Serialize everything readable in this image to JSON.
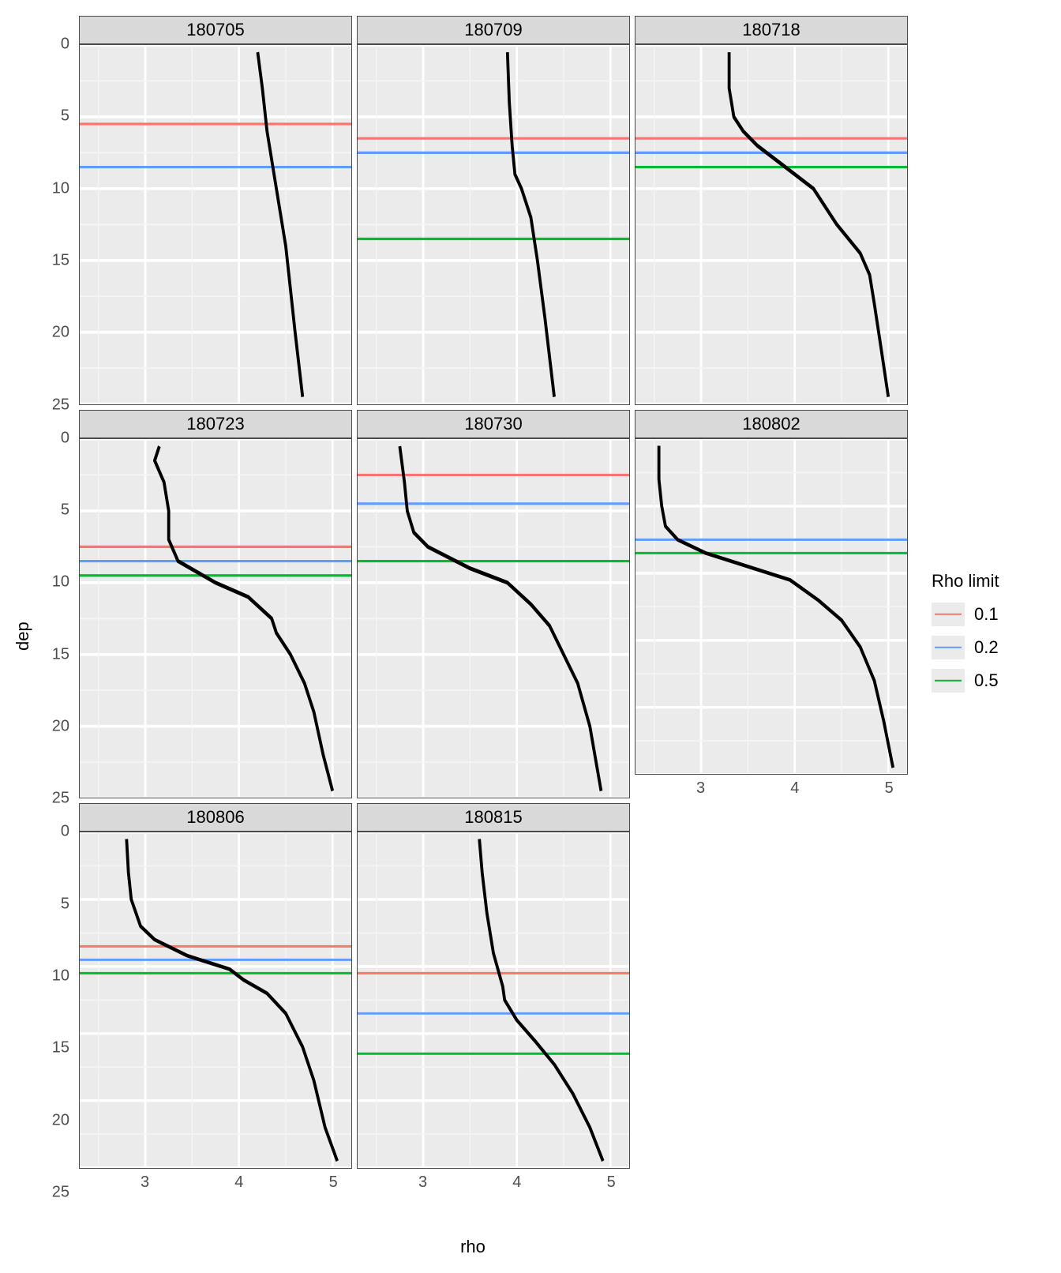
{
  "chart_data": {
    "type": "line",
    "xlabel": "rho",
    "ylabel": "dep",
    "xlim": [
      2.3,
      5.2
    ],
    "ylim_reversed": true,
    "ylim": [
      0,
      25
    ],
    "y_ticks": [
      0,
      5,
      10,
      15,
      20,
      25
    ],
    "x_ticks": [
      3,
      4,
      5
    ],
    "legend_title": "Rho limit",
    "legend": [
      {
        "label": "0.1",
        "color": "#F8766D"
      },
      {
        "label": "0.2",
        "color": "#619CFF"
      },
      {
        "label": "0.5",
        "color": "#00BA38"
      }
    ],
    "facets": [
      {
        "name": "180705",
        "col": 0,
        "row": 0,
        "profile": [
          [
            4.2,
            0.5
          ],
          [
            4.25,
            3
          ],
          [
            4.3,
            6
          ],
          [
            4.4,
            10
          ],
          [
            4.5,
            14
          ],
          [
            4.55,
            17
          ],
          [
            4.6,
            20
          ],
          [
            4.68,
            24.5
          ]
        ],
        "hlines": {
          "0.1": 5.5,
          "0.2": 8.5,
          "0.5": null
        }
      },
      {
        "name": "180709",
        "col": 1,
        "row": 0,
        "profile": [
          [
            3.9,
            0.5
          ],
          [
            3.92,
            4
          ],
          [
            3.95,
            7
          ],
          [
            3.98,
            9
          ],
          [
            4.05,
            10
          ],
          [
            4.15,
            12
          ],
          [
            4.22,
            15
          ],
          [
            4.3,
            19
          ],
          [
            4.4,
            24.5
          ]
        ],
        "hlines": {
          "0.1": 6.5,
          "0.2": 7.5,
          "0.5": 13.5
        }
      },
      {
        "name": "180718",
        "col": 2,
        "row": 0,
        "profile": [
          [
            3.3,
            0.5
          ],
          [
            3.3,
            3
          ],
          [
            3.35,
            5
          ],
          [
            3.45,
            6
          ],
          [
            3.6,
            7
          ],
          [
            3.9,
            8.5
          ],
          [
            4.2,
            10
          ],
          [
            4.4,
            12
          ],
          [
            4.45,
            12.5
          ],
          [
            4.7,
            14.5
          ],
          [
            4.8,
            16
          ],
          [
            4.85,
            18
          ],
          [
            4.92,
            21
          ],
          [
            5.0,
            24.5
          ]
        ],
        "hlines": {
          "0.1": 6.5,
          "0.2": 7.5,
          "0.5": 8.5
        }
      },
      {
        "name": "180723",
        "col": 0,
        "row": 1,
        "profile": [
          [
            3.15,
            0.5
          ],
          [
            3.1,
            1.5
          ],
          [
            3.2,
            3
          ],
          [
            3.25,
            5
          ],
          [
            3.25,
            7
          ],
          [
            3.35,
            8.5
          ],
          [
            3.75,
            10
          ],
          [
            4.1,
            11
          ],
          [
            4.35,
            12.5
          ],
          [
            4.4,
            13.5
          ],
          [
            4.55,
            15
          ],
          [
            4.7,
            17
          ],
          [
            4.8,
            19
          ],
          [
            4.9,
            22
          ],
          [
            5.0,
            24.5
          ]
        ],
        "hlines": {
          "0.1": 7.5,
          "0.2": 8.5,
          "0.5": 9.5
        }
      },
      {
        "name": "180730",
        "col": 1,
        "row": 1,
        "profile": [
          [
            2.75,
            0.5
          ],
          [
            2.8,
            3
          ],
          [
            2.83,
            5
          ],
          [
            2.9,
            6.5
          ],
          [
            3.05,
            7.5
          ],
          [
            3.5,
            9
          ],
          [
            3.9,
            10
          ],
          [
            4.15,
            11.5
          ],
          [
            4.35,
            13
          ],
          [
            4.5,
            15
          ],
          [
            4.65,
            17
          ],
          [
            4.78,
            20
          ],
          [
            4.9,
            24.5
          ]
        ],
        "hlines": {
          "0.1": 2.5,
          "0.2": 4.5,
          "0.5": 8.5
        }
      },
      {
        "name": "180802",
        "col": 2,
        "row": 1,
        "profile": [
          [
            2.55,
            0.5
          ],
          [
            2.55,
            3
          ],
          [
            2.58,
            5
          ],
          [
            2.62,
            6.5
          ],
          [
            2.75,
            7.5
          ],
          [
            3.05,
            8.5
          ],
          [
            3.5,
            9.5
          ],
          [
            3.95,
            10.5
          ],
          [
            4.25,
            12
          ],
          [
            4.5,
            13.5
          ],
          [
            4.7,
            15.5
          ],
          [
            4.85,
            18
          ],
          [
            4.95,
            21
          ],
          [
            5.05,
            24.5
          ]
        ],
        "hlines": {
          "0.1": null,
          "0.2": 7.5,
          "0.5": 8.5
        }
      },
      {
        "name": "180806",
        "col": 0,
        "row": 2,
        "profile": [
          [
            2.8,
            0.5
          ],
          [
            2.82,
            3
          ],
          [
            2.85,
            5
          ],
          [
            2.95,
            7
          ],
          [
            3.1,
            8
          ],
          [
            3.45,
            9.2
          ],
          [
            3.9,
            10.2
          ],
          [
            4.05,
            11
          ],
          [
            4.3,
            12
          ],
          [
            4.5,
            13.5
          ],
          [
            4.68,
            16
          ],
          [
            4.8,
            18.5
          ],
          [
            4.92,
            22
          ],
          [
            5.05,
            24.5
          ]
        ],
        "hlines": {
          "0.1": 8.5,
          "0.2": 9.5,
          "0.5": 10.5
        }
      },
      {
        "name": "180815",
        "col": 1,
        "row": 2,
        "profile": [
          [
            3.6,
            0.5
          ],
          [
            3.63,
            3
          ],
          [
            3.68,
            6
          ],
          [
            3.75,
            9
          ],
          [
            3.85,
            11.5
          ],
          [
            3.87,
            12.5
          ],
          [
            4.0,
            14
          ],
          [
            4.2,
            15.6
          ],
          [
            4.4,
            17.3
          ],
          [
            4.6,
            19.5
          ],
          [
            4.78,
            22
          ],
          [
            4.92,
            24.5
          ]
        ],
        "hlines": {
          "0.1": 10.5,
          "0.2": 13.5,
          "0.5": 16.5
        }
      }
    ]
  }
}
